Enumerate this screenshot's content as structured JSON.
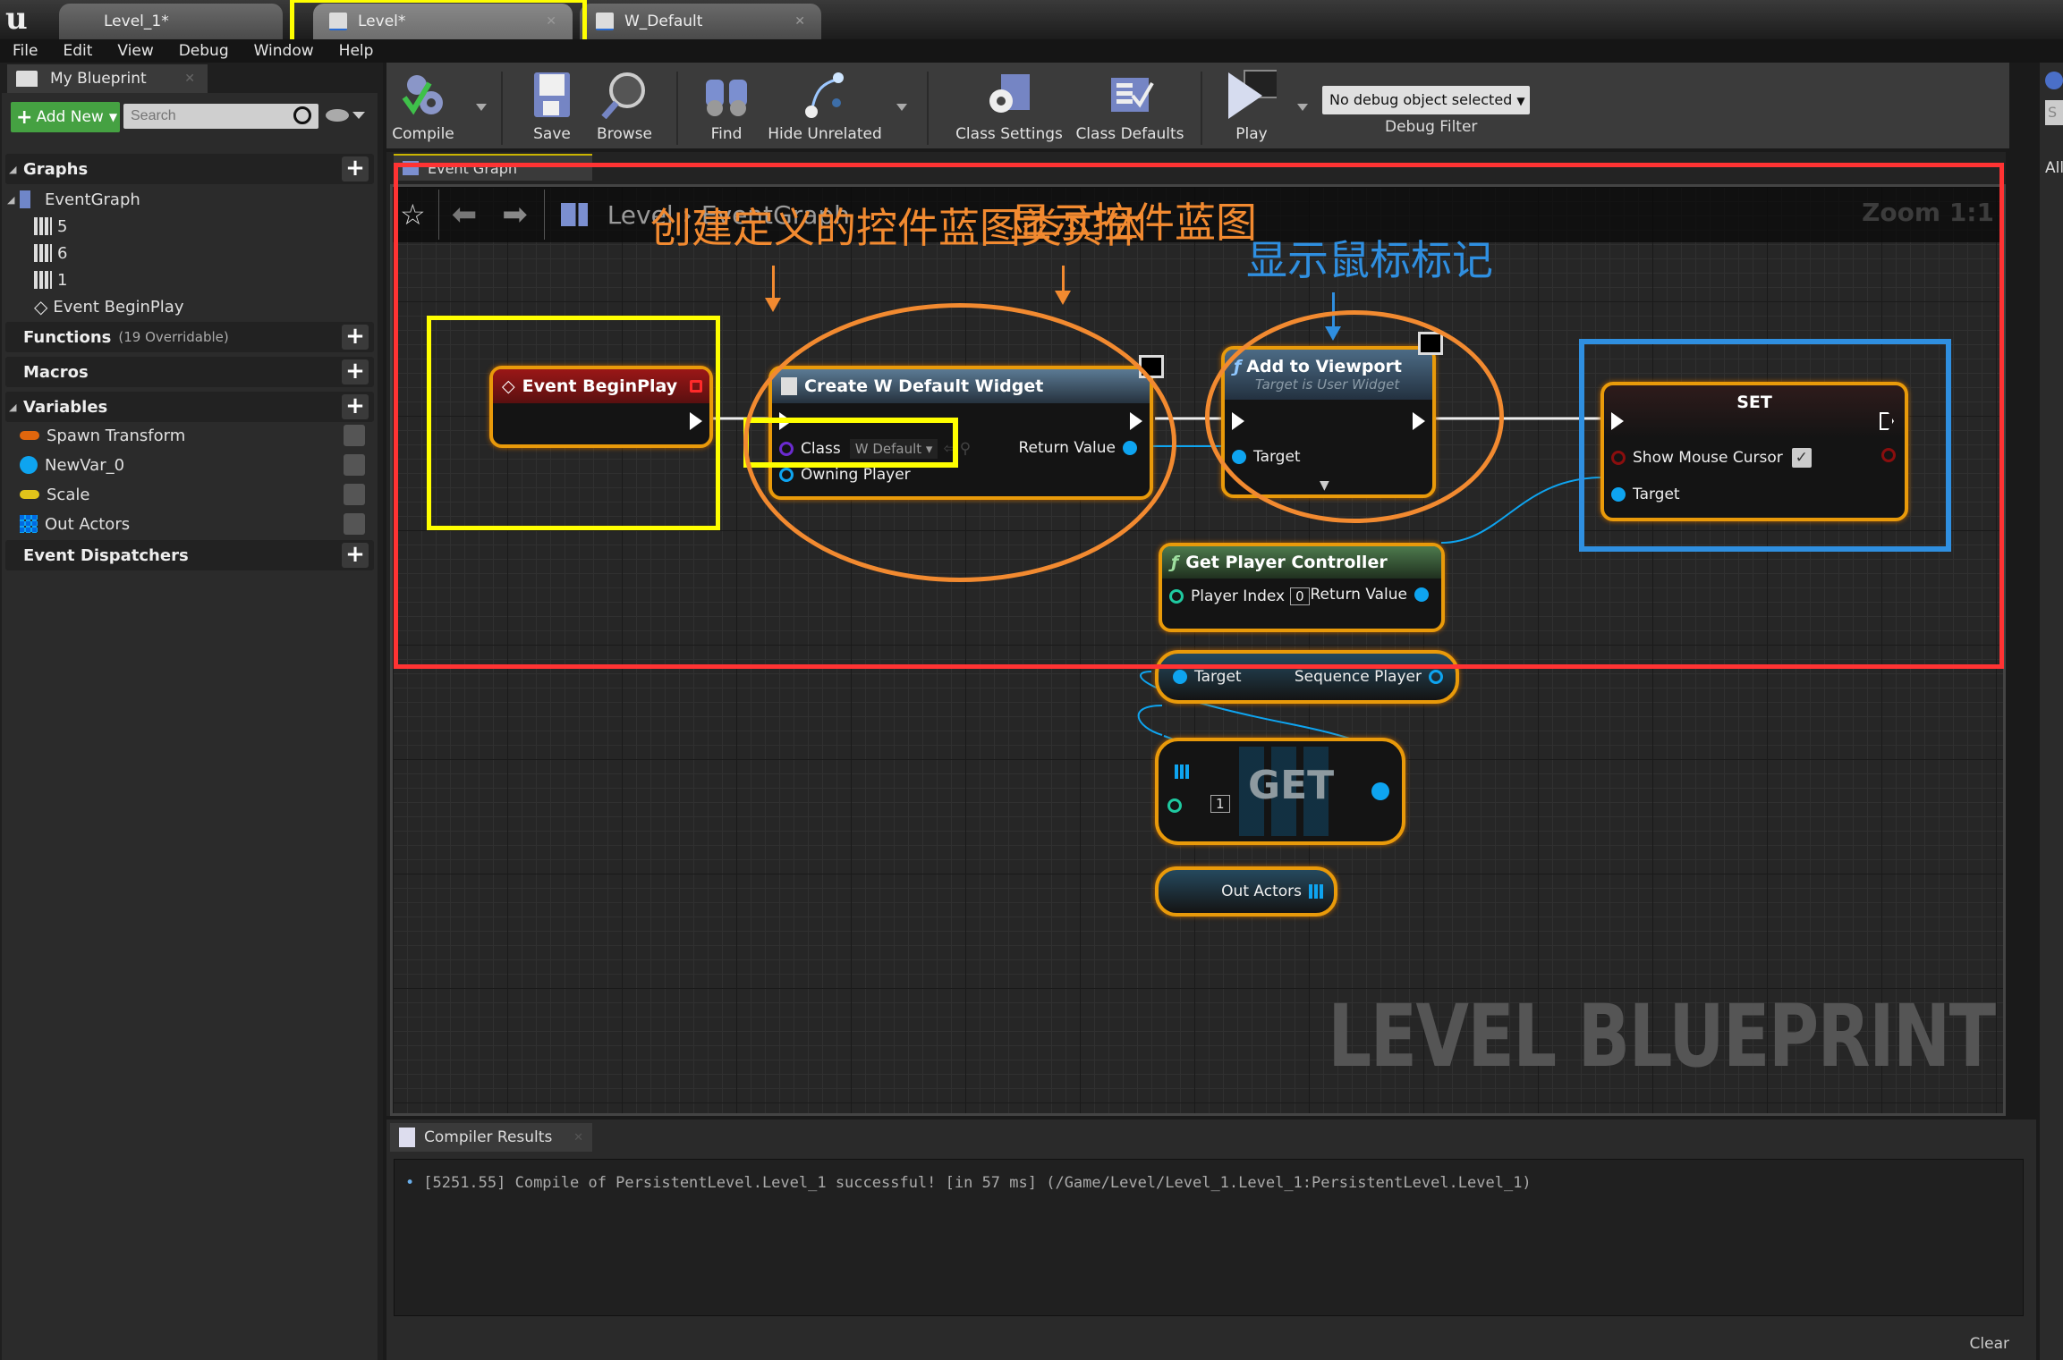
{
  "titlebar": {
    "tabs": [
      {
        "label": "Level_1*",
        "icon": "level-icon",
        "active": false
      },
      {
        "label": "Level*",
        "icon": "book-icon",
        "active": true
      },
      {
        "label": "W_Default",
        "icon": "widget-icon",
        "active": false
      }
    ]
  },
  "menu": [
    "File",
    "Edit",
    "View",
    "Debug",
    "Window",
    "Help"
  ],
  "my_blueprint": {
    "tab_label": "My Blueprint",
    "add_new_label": "Add New",
    "search_placeholder": "Search",
    "graphs": {
      "label": "Graphs",
      "event_graph": "EventGraph",
      "children": [
        "5",
        "6",
        "1",
        "Event BeginPlay"
      ]
    },
    "functions": {
      "label": "Functions",
      "sub": "(19 Overridable)"
    },
    "macros": {
      "label": "Macros"
    },
    "variables": {
      "label": "Variables",
      "items": [
        {
          "name": "Spawn Transform",
          "color": "#e0660d",
          "shape": "pill"
        },
        {
          "name": "NewVar_0",
          "color": "#0ea4f0",
          "shape": "circle"
        },
        {
          "name": "Scale",
          "color": "#e1c41a",
          "shape": "pill"
        },
        {
          "name": "Out Actors",
          "color": "#0ea4f0",
          "shape": "grid"
        }
      ]
    },
    "event_dispatchers": {
      "label": "Event Dispatchers"
    }
  },
  "toolbar": {
    "compile": "Compile",
    "save": "Save",
    "browse": "Browse",
    "find": "Find",
    "hide_unrelated": "Hide Unrelated",
    "class_settings": "Class Settings",
    "class_defaults": "Class Defaults",
    "play": "Play",
    "debug_object": "No debug object selected",
    "debug_filter": "Debug Filter"
  },
  "right_panel": {
    "search_char": "S",
    "all_label": "All"
  },
  "graph": {
    "tab_label": "Event Graph",
    "breadcrumb": [
      "Level",
      "EventGraph"
    ],
    "zoom": "Zoom 1:1",
    "watermark": "LEVEL BLUEPRINT",
    "nodes": {
      "begin_play": {
        "title": "Event BeginPlay"
      },
      "create_widget": {
        "title": "Create W Default Widget",
        "class_label": "Class",
        "class_value": "W Default",
        "return_label": "Return Value",
        "owning_label": "Owning Player"
      },
      "add_viewport": {
        "title": "Add to Viewport",
        "subtitle": "Target is User Widget",
        "target_label": "Target"
      },
      "set_node": {
        "title": "SET",
        "show_cursor_label": "Show Mouse Cursor",
        "show_cursor_checked": true,
        "target_label": "Target"
      },
      "get_player_controller": {
        "title": "Get Player Controller",
        "player_index_label": "Player Index",
        "player_index_value": "0",
        "return_label": "Return Value"
      },
      "sequence_player": {
        "target_label": "Target",
        "output_label": "Sequence Player"
      },
      "get_array": {
        "title": "GET",
        "index_value": "1"
      },
      "out_actors": {
        "label": "Out Actors"
      }
    },
    "annotations": {
      "create_label": "创建定义的控件蓝图类实体",
      "viewport_label": "显示控件蓝图",
      "cursor_label": "显示鼠标标记",
      "orange": "#f28a30",
      "blue": "#2f8fe0",
      "yellow": "#ffff00",
      "red": "#ff3333"
    }
  },
  "compiler": {
    "tab_label": "Compiler Results",
    "message": "[5251.55] Compile of PersistentLevel.Level_1 successful! [in 57 ms] (/Game/Level/Level_1.Level_1:PersistentLevel.Level_1)",
    "clear_label": "Clear"
  }
}
